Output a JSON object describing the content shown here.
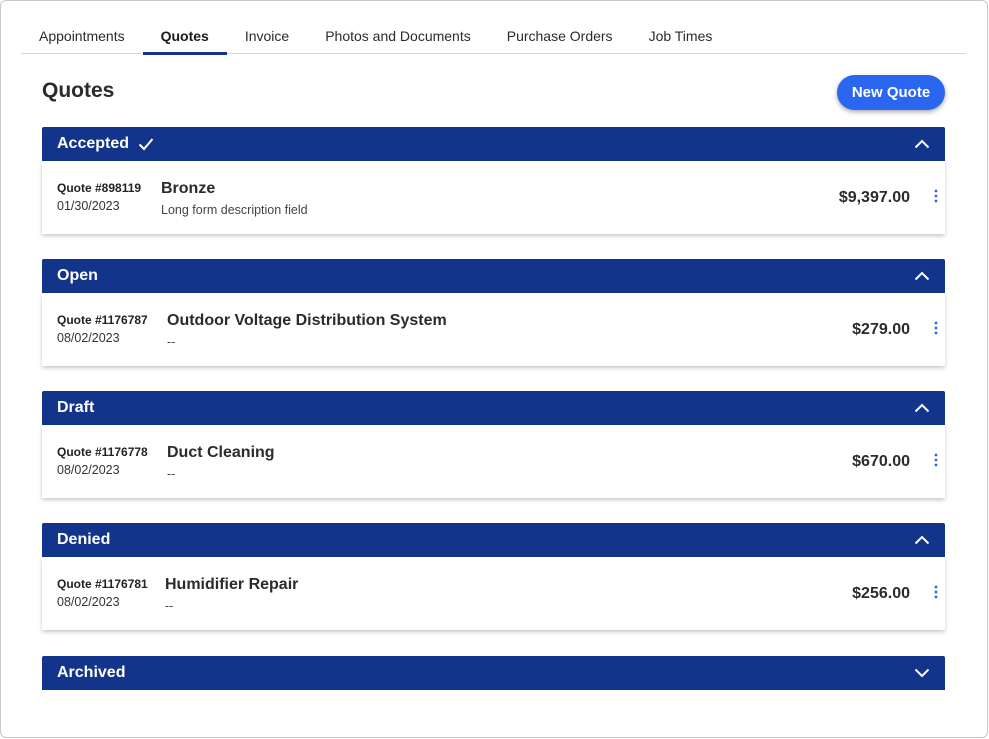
{
  "tabs": [
    {
      "label": "Appointments",
      "active": false
    },
    {
      "label": "Quotes",
      "active": true
    },
    {
      "label": "Invoice",
      "active": false
    },
    {
      "label": "Photos and Documents",
      "active": false
    },
    {
      "label": "Purchase Orders",
      "active": false
    },
    {
      "label": "Job Times",
      "active": false
    }
  ],
  "page": {
    "title": "Quotes",
    "new_quote_label": "New Quote"
  },
  "groups": [
    {
      "label": "Accepted",
      "checked": true,
      "expanded": true,
      "quotes": [
        {
          "number": "Quote #898119",
          "date": "01/30/2023",
          "title": "Bronze",
          "description": "Long form description field",
          "amount": "$9,397.00"
        }
      ]
    },
    {
      "label": "Open",
      "checked": false,
      "expanded": true,
      "quotes": [
        {
          "number": "Quote #1176787",
          "date": "08/02/2023",
          "title": "Outdoor Voltage Distribution System",
          "description": "--",
          "amount": "$279.00"
        }
      ]
    },
    {
      "label": "Draft",
      "checked": false,
      "expanded": true,
      "quotes": [
        {
          "number": "Quote #1176778",
          "date": "08/02/2023",
          "title": "Duct Cleaning",
          "description": "--",
          "amount": "$670.00"
        }
      ]
    },
    {
      "label": "Denied",
      "checked": false,
      "expanded": true,
      "quotes": [
        {
          "number": "Quote #1176781",
          "date": "08/02/2023",
          "title": "Humidifier Repair",
          "description": "--",
          "amount": "$256.00"
        }
      ]
    },
    {
      "label": "Archived",
      "checked": false,
      "expanded": false,
      "quotes": []
    }
  ],
  "colors": {
    "header_bg": "#12348a",
    "primary_button": "#2a66f0",
    "kebab": "#2a66f0"
  }
}
